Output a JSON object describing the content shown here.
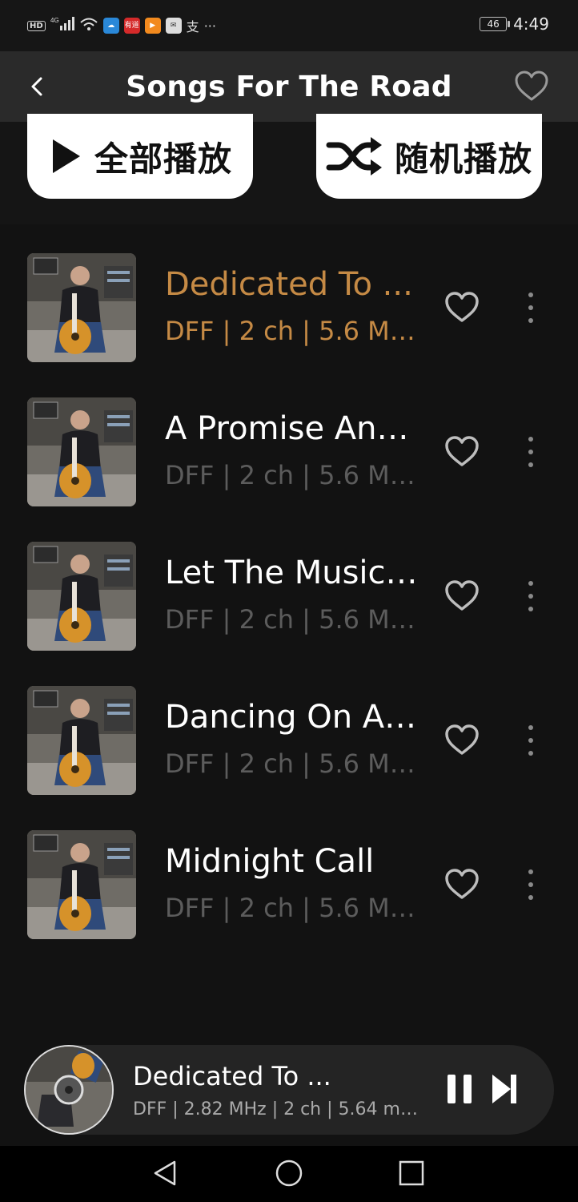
{
  "status_bar": {
    "left_icons": [
      "hd-icon",
      "signal-4g-icon",
      "wifi-icon",
      "cloud-app-icon",
      "youdao-app-icon",
      "video-app-icon",
      "mail-app-icon",
      "alipay-icon",
      "more-dots-icon"
    ],
    "badge_text": "有道",
    "battery": "46",
    "time": "4:49"
  },
  "header": {
    "title": "Songs For The Road",
    "back_icon": "chevron-left-icon",
    "favorite_icon": "heart-outline-icon"
  },
  "actions": {
    "play_all_label": "全部播放",
    "shuffle_label": "随机播放"
  },
  "tracks": [
    {
      "title": "Dedicated To ...",
      "meta": "DFF | 2 ch | 5.6 Mb...",
      "active": true
    },
    {
      "title": "A Promise And...",
      "meta": "DFF | 2 ch | 5.6 Mb...",
      "active": false
    },
    {
      "title": "Let The Music ...",
      "meta": "DFF | 2 ch | 5.6 Mb...",
      "active": false
    },
    {
      "title": "Dancing On A ...",
      "meta": "DFF | 2 ch | 5.6 Mb...",
      "active": false
    },
    {
      "title": "Midnight Call",
      "meta": "DFF | 2 ch | 5.6 Mb...",
      "active": false
    }
  ],
  "now_playing": {
    "title": "Dedicated To ...",
    "meta": "DFF | 2.82 MHz | 2 ch | 5.64 mbp..."
  },
  "colors": {
    "accent": "#c58a45",
    "background": "#121212",
    "header": "#2a2a2a",
    "muted_text": "#5c5c5c"
  }
}
